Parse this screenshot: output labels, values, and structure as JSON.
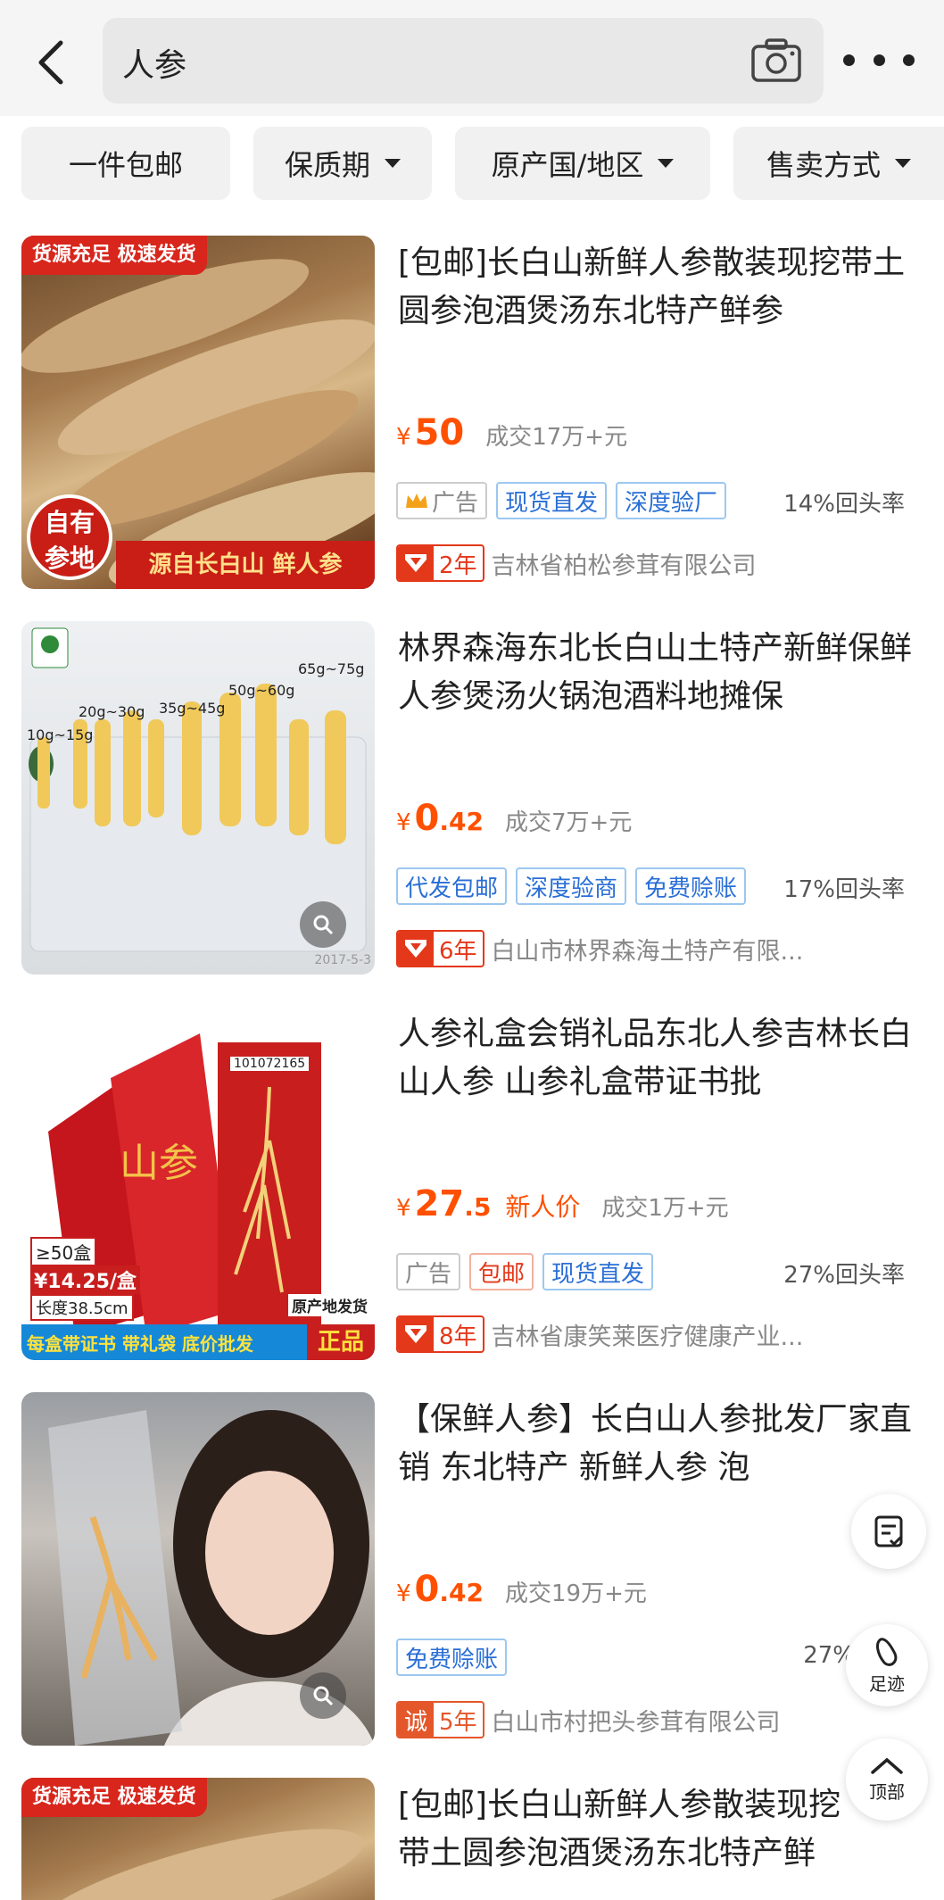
{
  "search": {
    "query": "人参"
  },
  "filters": [
    {
      "label": "一件包邮",
      "has_dropdown": false
    },
    {
      "label": "保质期",
      "has_dropdown": true
    },
    {
      "label": "原产国/地区",
      "has_dropdown": true
    },
    {
      "label": "售卖方式",
      "has_dropdown": true
    }
  ],
  "products": [
    {
      "title": "[包邮]长白山新鲜人参散装现挖带土圆参泡酒煲汤东北特产鲜参",
      "thumb_banner": "货源充足 极速发货",
      "thumb_seal": "自有参地",
      "thumb_caption": "源自长白山 鲜人参",
      "price_int": "50",
      "price_dec": "",
      "new_price_label": "",
      "sold": "成交17万+元",
      "tags": [
        "广告",
        "现货直发",
        "深度验厂"
      ],
      "repeat_rate": "14%回头率",
      "years": "2年",
      "shop": "吉林省柏松参茸有限公司"
    },
    {
      "title": "林界森海东北长白山土特产新鲜保鲜人参煲汤火锅泡酒料地摊保",
      "thumb_sizes": [
        "10g~15g",
        "20g~30g",
        "35g~45g",
        "50g~60g",
        "65g~75g"
      ],
      "thumb_date": "2017-5-3",
      "price_int": "0",
      "price_dec": ".42",
      "new_price_label": "",
      "sold": "成交7万+元",
      "tags": [
        "代发包邮",
        "深度验商",
        "免费赊账"
      ],
      "repeat_rate": "17%回头率",
      "years": "6年",
      "shop": "白山市林界森海土特产有限..."
    },
    {
      "title": "人参礼盒会销礼品东北人参吉林长白山人参 山参礼盒带证书批",
      "thumb_code": "101072165",
      "thumb_qty": "≥50盒",
      "thumb_unit_price": "¥14.25/盒",
      "thumb_length": "长度38.5cm",
      "thumb_origin": "原产地发货",
      "thumb_genuine": "正品",
      "thumb_strip": "每盒带证书 带礼袋 底价批发",
      "price_int": "27",
      "price_dec": ".5",
      "new_price_label": "新人价",
      "sold": "成交1万+元",
      "tags": [
        "广告",
        "包邮",
        "现货直发"
      ],
      "repeat_rate": "27%回头率",
      "years": "8年",
      "shop": "吉林省康笑莱医疗健康产业..."
    },
    {
      "title": "【保鲜人参】长白山人参批发厂家直销 东北特产 新鲜人参 泡",
      "price_int": "0",
      "price_dec": ".42",
      "new_price_label": "",
      "sold": "成交19万+元",
      "tags": [
        "免费赊账"
      ],
      "repeat_rate": "27%",
      "years": "5年",
      "badge_char": "诚",
      "shop": "白山市村把头参茸有限公司"
    },
    {
      "title": "[包邮]长白山新鲜人参散装现挖带土圆参泡酒煲汤东北特产鲜参",
      "thumb_banner": "货源充足 极速发货"
    }
  ],
  "fabs": {
    "footprint": "足迹",
    "top": "顶部"
  },
  "colors": {
    "price": "#ff5000",
    "badge_red": "#e4381a",
    "tag_blue": "#2a6fd6"
  }
}
